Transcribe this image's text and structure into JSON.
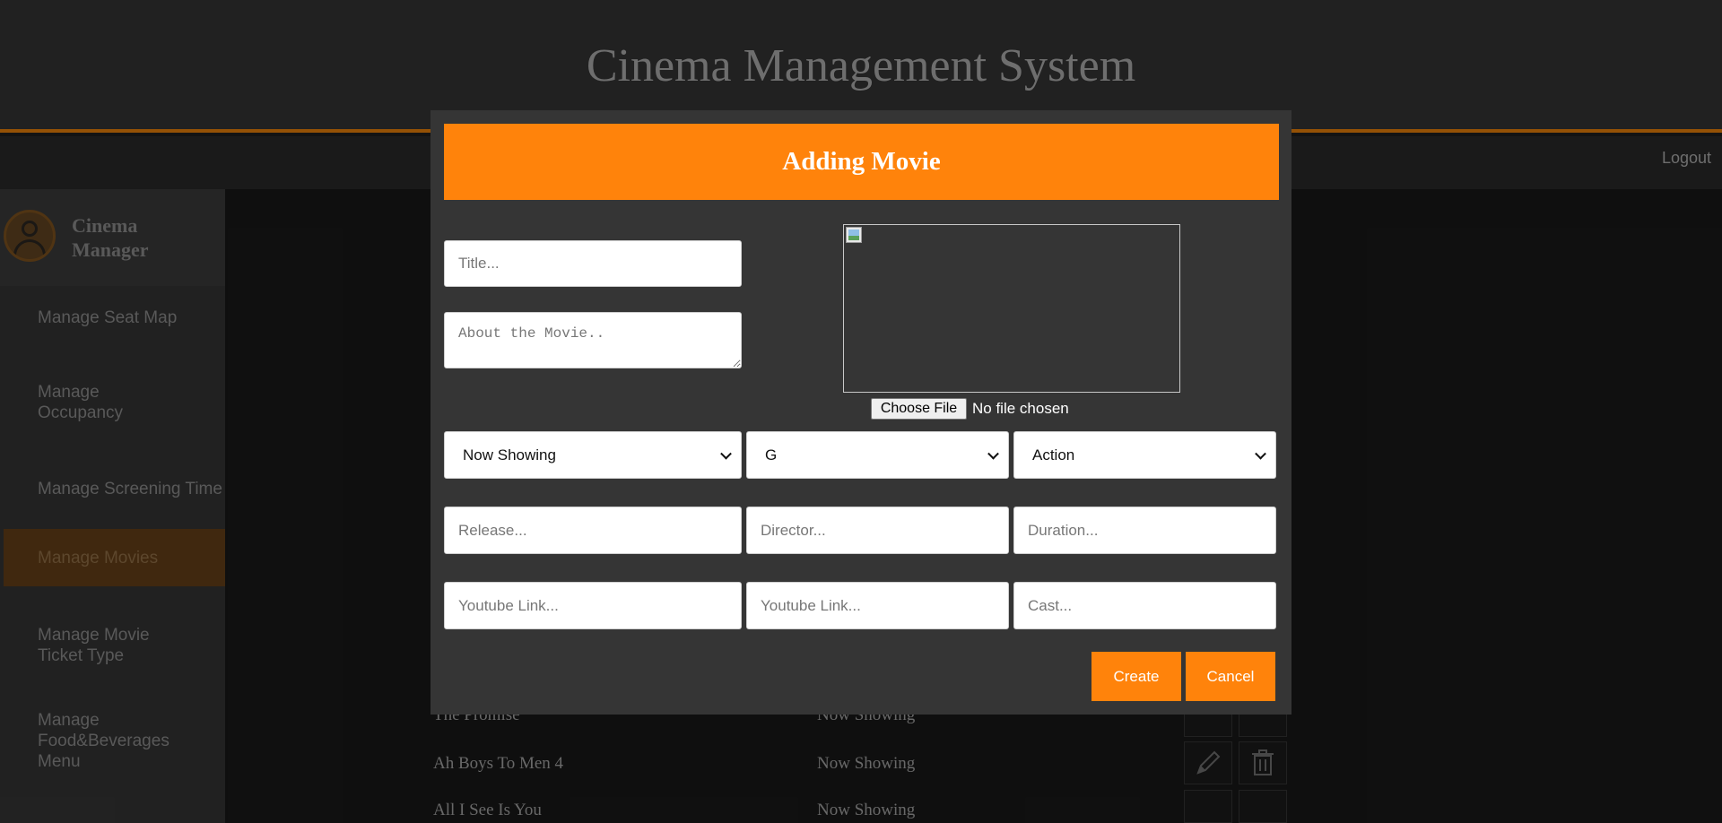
{
  "app": {
    "title": "Cinema Management System",
    "logout_label": "Logout"
  },
  "sidebar": {
    "profile_name": "Cinema Manager",
    "items": [
      {
        "label": "Manage Seat Map"
      },
      {
        "label": "Manage Occupancy"
      },
      {
        "label": "Manage Screening Time"
      },
      {
        "label": "Manage Movies",
        "active": true
      },
      {
        "label": "Manage Movie Ticket Type"
      },
      {
        "label": "Manage Food&Beverages Menu"
      }
    ]
  },
  "movies_table": {
    "rows": [
      {
        "title": "The Promise",
        "status": "Now Showing"
      },
      {
        "title": "Ah Boys To Men 4",
        "status": "Now Showing"
      },
      {
        "title": "All I See Is You",
        "status": "Now Showing"
      }
    ]
  },
  "modal": {
    "title": "Adding Movie",
    "title_placeholder": "Title...",
    "about_placeholder": "About the Movie..",
    "file_button_label": "Choose File",
    "file_status": "No file chosen",
    "status_select": "Now Showing",
    "rating_select": "G",
    "genre_select": "Action",
    "release_placeholder": "Release...",
    "director_placeholder": "Director...",
    "duration_placeholder": "Duration...",
    "youtube_placeholder_1": "Youtube Link...",
    "youtube_placeholder_2": "Youtube Link...",
    "cast_placeholder": "Cast...",
    "create_label": "Create",
    "cancel_label": "Cancel"
  },
  "colors": {
    "accent": "#ff830b",
    "header_bg": "#3a3a3a",
    "modal_bg": "#353535"
  }
}
